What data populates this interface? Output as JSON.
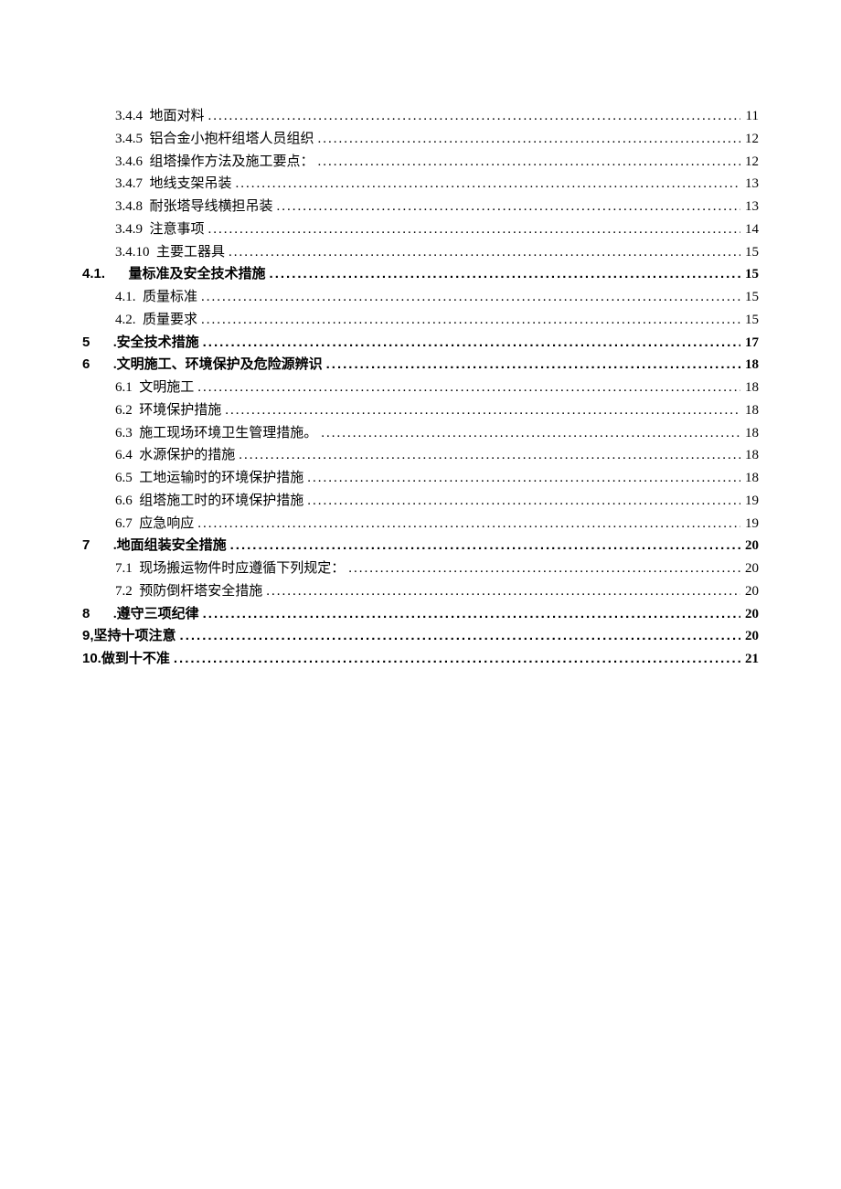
{
  "toc": [
    {
      "indent": 1,
      "bold": false,
      "num": "3.4.4",
      "title": "地面对料",
      "page": "11",
      "space_after_num": true
    },
    {
      "indent": 1,
      "bold": false,
      "num": "3.4.5",
      "title": "铝合金小抱杆组塔人员组织",
      "page": "12",
      "space_after_num": true
    },
    {
      "indent": 1,
      "bold": false,
      "num": "3.4.6",
      "title": "组塔操作方法及施工要点：",
      "page": "12",
      "space_after_num": true
    },
    {
      "indent": 1,
      "bold": false,
      "num": "3.4.7",
      "title": "地线支架吊装",
      "page": "13",
      "space_after_num": true
    },
    {
      "indent": 1,
      "bold": false,
      "num": "3.4.8",
      "title": "耐张塔导线横担吊装",
      "page": "13",
      "space_after_num": true
    },
    {
      "indent": 1,
      "bold": false,
      "num": "3.4.9",
      "title": "注意事项",
      "page": "14",
      "space_after_num": true
    },
    {
      "indent": 1,
      "bold": false,
      "num": "3.4.10",
      "title": "主要工器具",
      "page": "15",
      "space_after_num": true
    },
    {
      "indent": 0,
      "bold": true,
      "num": "4.1.",
      "title": "量标准及安全技术措施",
      "page": "15",
      "space_after_num": false,
      "wide_gap": true
    },
    {
      "indent": 1,
      "bold": false,
      "num": "4.1.",
      "title": "质量标准",
      "page": "15",
      "space_after_num": true
    },
    {
      "indent": 1,
      "bold": false,
      "num": "4.2.",
      "title": "质量要求",
      "page": "15",
      "space_after_num": true
    },
    {
      "indent": 0,
      "bold": true,
      "num": "5",
      "title": ".安全技术措施",
      "page": "17",
      "space_after_num": false,
      "wide_gap": true
    },
    {
      "indent": 0,
      "bold": true,
      "num": "6",
      "title": ".文明施工、环境保护及危险源辨识",
      "page": "18",
      "space_after_num": false,
      "wide_gap": true
    },
    {
      "indent": 1,
      "bold": false,
      "num": "6.1",
      "title": "文明施工",
      "page": "18",
      "space_after_num": true
    },
    {
      "indent": 1,
      "bold": false,
      "num": "6.2",
      "title": "环境保护措施",
      "page": "18",
      "space_after_num": true
    },
    {
      "indent": 1,
      "bold": false,
      "num": "6.3",
      "title": "施工现场环境卫生管理措施。",
      "page": "18",
      "space_after_num": true
    },
    {
      "indent": 1,
      "bold": false,
      "num": "6.4",
      "title": "水源保护的措施",
      "page": "18",
      "space_after_num": true
    },
    {
      "indent": 1,
      "bold": false,
      "num": "6.5",
      "title": "工地运输时的环境保护措施",
      "page": "18",
      "space_after_num": true
    },
    {
      "indent": 1,
      "bold": false,
      "num": "6.6",
      "title": "组塔施工时的环境保护措施",
      "page": "19",
      "space_after_num": true
    },
    {
      "indent": 1,
      "bold": false,
      "num": "6.7",
      "title": "应急响应",
      "page": "19",
      "space_after_num": true
    },
    {
      "indent": 0,
      "bold": true,
      "num": "7",
      "title": ".地面组装安全措施",
      "page": "20",
      "space_after_num": false,
      "wide_gap": true
    },
    {
      "indent": 1,
      "bold": false,
      "num": "7.1",
      "title": "现场搬运物件时应遵循下列规定：",
      "page": "20",
      "space_after_num": true
    },
    {
      "indent": 1,
      "bold": false,
      "num": "7.2",
      "title": "预防倒杆塔安全措施",
      "page": "20",
      "space_after_num": true
    },
    {
      "indent": 0,
      "bold": true,
      "num": "8",
      "title": ".遵守三项纪律",
      "page": "20",
      "space_after_num": false,
      "wide_gap": true
    },
    {
      "indent": 0,
      "bold": true,
      "num": "9,",
      "title": "坚持十项注意",
      "page": "20",
      "space_after_num": false,
      "wide_gap": false
    },
    {
      "indent": 0,
      "bold": true,
      "num": "10.",
      "title": "做到十不准",
      "page": "21",
      "space_after_num": false,
      "wide_gap": false
    }
  ]
}
